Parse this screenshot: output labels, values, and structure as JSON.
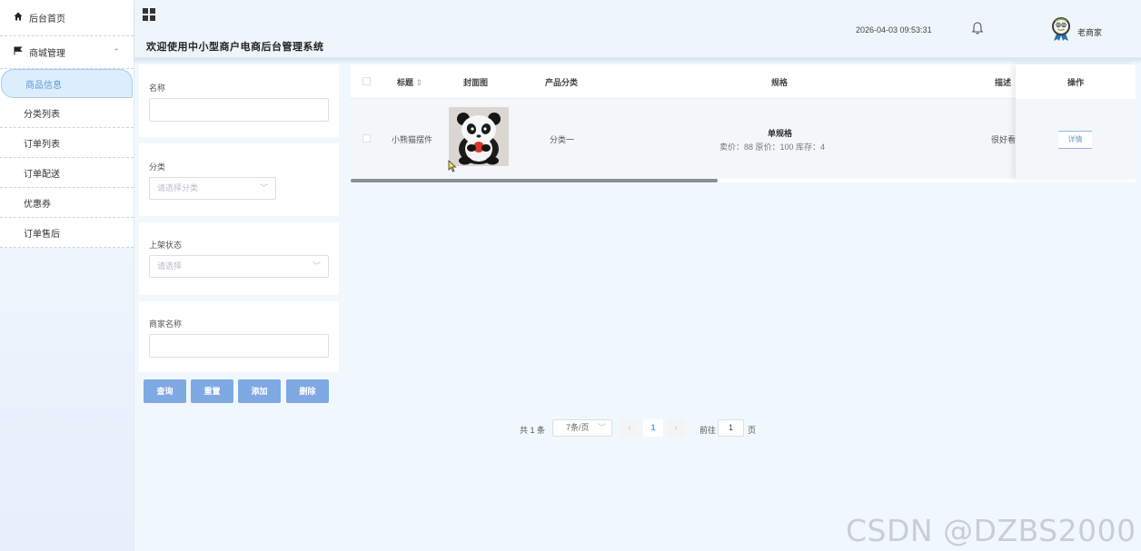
{
  "sidebar": {
    "home": "后台首页",
    "mall": "商城管理",
    "items": [
      "商品信息",
      "分类列表",
      "订单列表",
      "订单配送",
      "优惠券",
      "订单售后"
    ]
  },
  "header": {
    "title": "欢迎使用中小型商户电商后台管理系统",
    "datetime": "2026-04-03 09:53:31",
    "username": "老商家"
  },
  "filters": {
    "name_label": "名称",
    "name_value": "",
    "category_label": "分类",
    "category_placeholder": "请选择分类",
    "status_label": "上架状态",
    "status_placeholder": "请选择",
    "merchant_label": "商家名称",
    "merchant_value": ""
  },
  "buttons": {
    "query": "查询",
    "reset": "重置",
    "add": "添加",
    "delete": "删除"
  },
  "table": {
    "headers": {
      "title": "标题",
      "cover": "封面图",
      "category": "产品分类",
      "spec": "规格",
      "desc": "描述",
      "action": "操作"
    },
    "rows": [
      {
        "title": "小熊猫摆件",
        "category": "分类一",
        "spec_title": "单规格",
        "spec_detail": "卖价：88  原价：100  库存：4",
        "desc": "很好看",
        "action": "详情"
      }
    ]
  },
  "pagination": {
    "total": "共 1 条",
    "page_size": "7条/页",
    "current": "1",
    "goto_label": "前往",
    "goto_value": "1",
    "unit": "页"
  },
  "watermark": "CSDN @DZBS2000",
  "colors": {
    "accent": "#7ea9e3",
    "active_bg": "#dceefe",
    "page_bg": "#f0f8fd"
  }
}
